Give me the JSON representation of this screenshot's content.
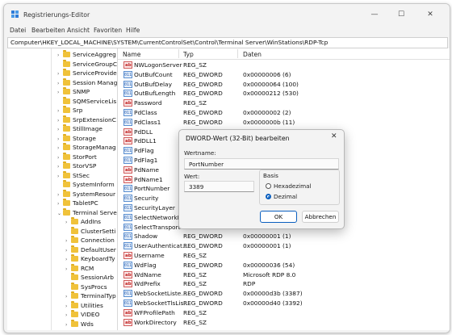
{
  "window": {
    "title": "Registrierungs-Editor",
    "controls": {
      "minimize": "—",
      "maximize": "☐",
      "close": "✕"
    }
  },
  "menu": [
    "Datei",
    "Bearbeiten",
    "Ansicht",
    "Favoriten",
    "Hilfe"
  ],
  "address": "Computer\\HKEY_LOCAL_MACHINE\\SYSTEM\\CurrentControlSet\\Control\\Terminal Server\\WinStations\\RDP-Tcp",
  "tree": [
    {
      "label": "ServiceAggreg",
      "level": 0,
      "expandable": true
    },
    {
      "label": "ServiceGroupC",
      "level": 0,
      "expandable": false
    },
    {
      "label": "ServiceProvide",
      "level": 0,
      "expandable": true
    },
    {
      "label": "Session Manag",
      "level": 0,
      "expandable": true
    },
    {
      "label": "SNMP",
      "level": 0,
      "expandable": true
    },
    {
      "label": "SQMServiceLis",
      "level": 0,
      "expandable": false
    },
    {
      "label": "Srp",
      "level": 0,
      "expandable": true
    },
    {
      "label": "SrpExtensionC",
      "level": 0,
      "expandable": true
    },
    {
      "label": "StillImage",
      "level": 0,
      "expandable": true
    },
    {
      "label": "Storage",
      "level": 0,
      "expandable": true
    },
    {
      "label": "StorageManag",
      "level": 0,
      "expandable": true
    },
    {
      "label": "StorPort",
      "level": 0,
      "expandable": true
    },
    {
      "label": "StorVSP",
      "level": 0,
      "expandable": true
    },
    {
      "label": "StSec",
      "level": 0,
      "expandable": true
    },
    {
      "label": "SystemInform",
      "level": 0,
      "expandable": false
    },
    {
      "label": "SystemResour",
      "level": 0,
      "expandable": true
    },
    {
      "label": "TabletPC",
      "level": 0,
      "expandable": true
    },
    {
      "label": "Terminal Serve",
      "level": 0,
      "expandable": true,
      "expanded": true
    },
    {
      "label": "AddIns",
      "level": 1,
      "expandable": true
    },
    {
      "label": "ClusterSetti",
      "level": 1,
      "expandable": false
    },
    {
      "label": "Connection",
      "level": 1,
      "expandable": true
    },
    {
      "label": "DefaultUser",
      "level": 1,
      "expandable": true
    },
    {
      "label": "KeyboardTy",
      "level": 1,
      "expandable": true
    },
    {
      "label": "RCM",
      "level": 1,
      "expandable": true
    },
    {
      "label": "SessionArb",
      "level": 1,
      "expandable": false
    },
    {
      "label": "SysProcs",
      "level": 1,
      "expandable": false
    },
    {
      "label": "TerminalTyp",
      "level": 1,
      "expandable": true
    },
    {
      "label": "Utilities",
      "level": 1,
      "expandable": true
    },
    {
      "label": "VIDEO",
      "level": 1,
      "expandable": true
    },
    {
      "label": "Wds",
      "level": 1,
      "expandable": true
    }
  ],
  "columns": {
    "name": "Name",
    "type": "Typ",
    "data": "Daten"
  },
  "values": [
    {
      "icon": "sz",
      "name": "NWLogonServer",
      "type": "REG_SZ",
      "data": ""
    },
    {
      "icon": "bin",
      "name": "OutBufCount",
      "type": "REG_DWORD",
      "data": "0x00000006 (6)"
    },
    {
      "icon": "bin",
      "name": "OutBufDelay",
      "type": "REG_DWORD",
      "data": "0x00000064 (100)"
    },
    {
      "icon": "bin",
      "name": "OutBufLength",
      "type": "REG_DWORD",
      "data": "0x00000212 (530)"
    },
    {
      "icon": "sz",
      "name": "Password",
      "type": "REG_SZ",
      "data": ""
    },
    {
      "icon": "bin",
      "name": "PdClass",
      "type": "REG_DWORD",
      "data": "0x00000002 (2)"
    },
    {
      "icon": "bin",
      "name": "PdClass1",
      "type": "REG_DWORD",
      "data": "0x0000000b (11)"
    },
    {
      "icon": "sz",
      "name": "PdDLL",
      "type": "REG_SZ",
      "data": "tdtcp"
    },
    {
      "icon": "sz",
      "name": "PdDLL1",
      "type": "",
      "data": ""
    },
    {
      "icon": "bin",
      "name": "PdFlag",
      "type": "",
      "data": ""
    },
    {
      "icon": "bin",
      "name": "PdFlag1",
      "type": "",
      "data": ""
    },
    {
      "icon": "sz",
      "name": "PdName",
      "type": "",
      "data": ""
    },
    {
      "icon": "sz",
      "name": "PdName1",
      "type": "",
      "data": ""
    },
    {
      "icon": "bin",
      "name": "PortNumber",
      "type": "",
      "data": ""
    },
    {
      "icon": "bin",
      "name": "Security",
      "type": "",
      "data": "0 00 00 30 00..."
    },
    {
      "icon": "bin",
      "name": "SecurityLayer",
      "type": "",
      "data": ""
    },
    {
      "icon": "bin",
      "name": "SelectNetworkD...",
      "type": "",
      "data": ""
    },
    {
      "icon": "bin",
      "name": "SelectTransport",
      "type": "",
      "data": ""
    },
    {
      "icon": "bin",
      "name": "Shadow",
      "type": "REG_DWORD",
      "data": "0x00000001 (1)"
    },
    {
      "icon": "bin",
      "name": "UserAuthenticat...",
      "type": "REG_DWORD",
      "data": "0x00000001 (1)"
    },
    {
      "icon": "sz",
      "name": "Username",
      "type": "REG_SZ",
      "data": ""
    },
    {
      "icon": "bin",
      "name": "WdFlag",
      "type": "REG_DWORD",
      "data": "0x00000036 (54)"
    },
    {
      "icon": "sz",
      "name": "WdName",
      "type": "REG_SZ",
      "data": "Microsoft RDP 8.0"
    },
    {
      "icon": "sz",
      "name": "WdPrefix",
      "type": "REG_SZ",
      "data": "RDP"
    },
    {
      "icon": "bin",
      "name": "WebSocketListe...",
      "type": "REG_DWORD",
      "data": "0x00000d3b (3387)"
    },
    {
      "icon": "bin",
      "name": "WebSocketTlsLis...",
      "type": "REG_DWORD",
      "data": "0x00000d40 (3392)"
    },
    {
      "icon": "sz",
      "name": "WFProfilePath",
      "type": "REG_SZ",
      "data": ""
    },
    {
      "icon": "sz",
      "name": "WorkDirectory",
      "type": "REG_SZ",
      "data": ""
    }
  ],
  "dialog": {
    "title": "DWORD-Wert (32-Bit) bearbeiten",
    "close": "✕",
    "name_label": "Wertname:",
    "name_value": "PortNumber",
    "data_label": "Wert:",
    "data_value": "3389",
    "base_label": "Basis",
    "radio_hex": "Hexadezimal",
    "radio_dec": "Dezimal",
    "selected": "dec",
    "ok": "OK",
    "cancel": "Abbrechen"
  },
  "colors": {
    "accent": "#0a5fbf",
    "folder": "#f0c23a"
  }
}
